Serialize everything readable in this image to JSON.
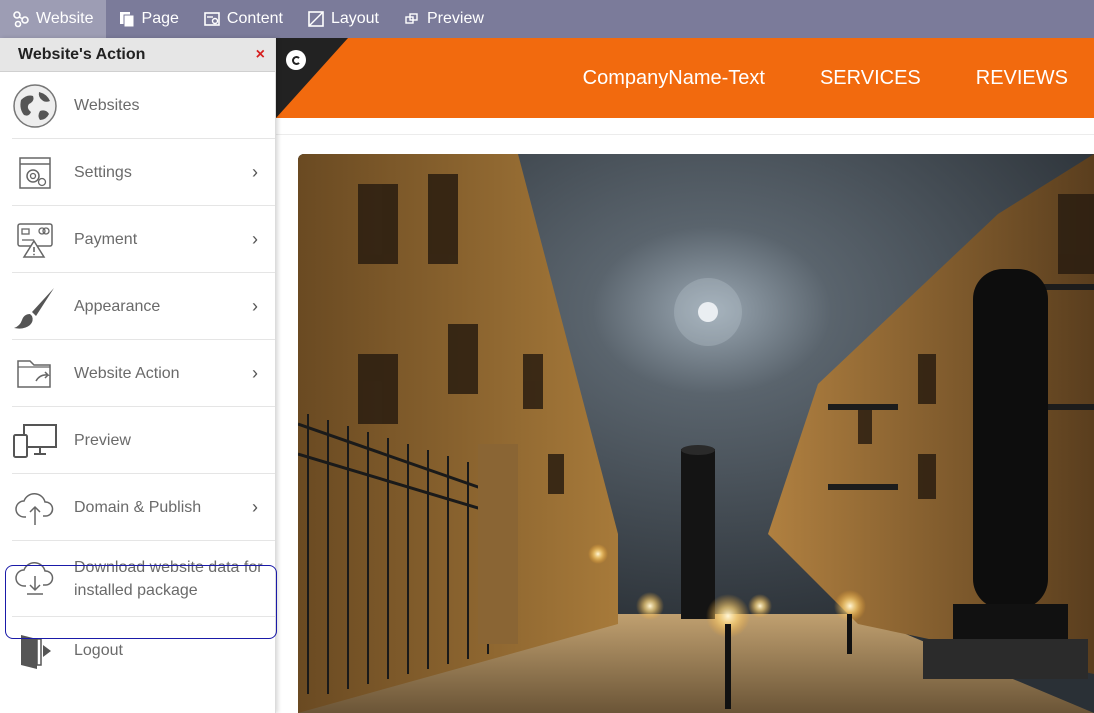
{
  "toolbar": {
    "items": [
      {
        "label": "Website",
        "icon": "sitemap-icon"
      },
      {
        "label": "Page",
        "icon": "pages-icon"
      },
      {
        "label": "Content",
        "icon": "content-icon"
      },
      {
        "label": "Layout",
        "icon": "layout-icon"
      },
      {
        "label": "Preview",
        "icon": "preview-icon"
      }
    ]
  },
  "panel": {
    "title": "Website's Action",
    "close": "×",
    "items": [
      {
        "label": "Websites",
        "icon": "globe-icon",
        "has_submenu": false
      },
      {
        "label": "Settings",
        "icon": "settings-window-icon",
        "has_submenu": true
      },
      {
        "label": "Payment",
        "icon": "payment-card-icon",
        "has_submenu": true
      },
      {
        "label": "Appearance",
        "icon": "paintbrush-icon",
        "has_submenu": true
      },
      {
        "label": "Website Action",
        "icon": "folder-share-icon",
        "has_submenu": true
      },
      {
        "label": "Preview",
        "icon": "devices-icon",
        "has_submenu": false
      },
      {
        "label": "Domain & Publish",
        "icon": "cloud-upload-icon",
        "has_submenu": true
      },
      {
        "label": "Download website data for installed package",
        "icon": "cloud-download-icon",
        "has_submenu": false
      },
      {
        "label": "Logout",
        "icon": "logout-door-icon",
        "has_submenu": false
      }
    ],
    "chevron": "›"
  },
  "site": {
    "nav": [
      "CompanyName-Text",
      "SERVICES",
      "REVIEWS"
    ],
    "header_color": "#f26a0e"
  }
}
